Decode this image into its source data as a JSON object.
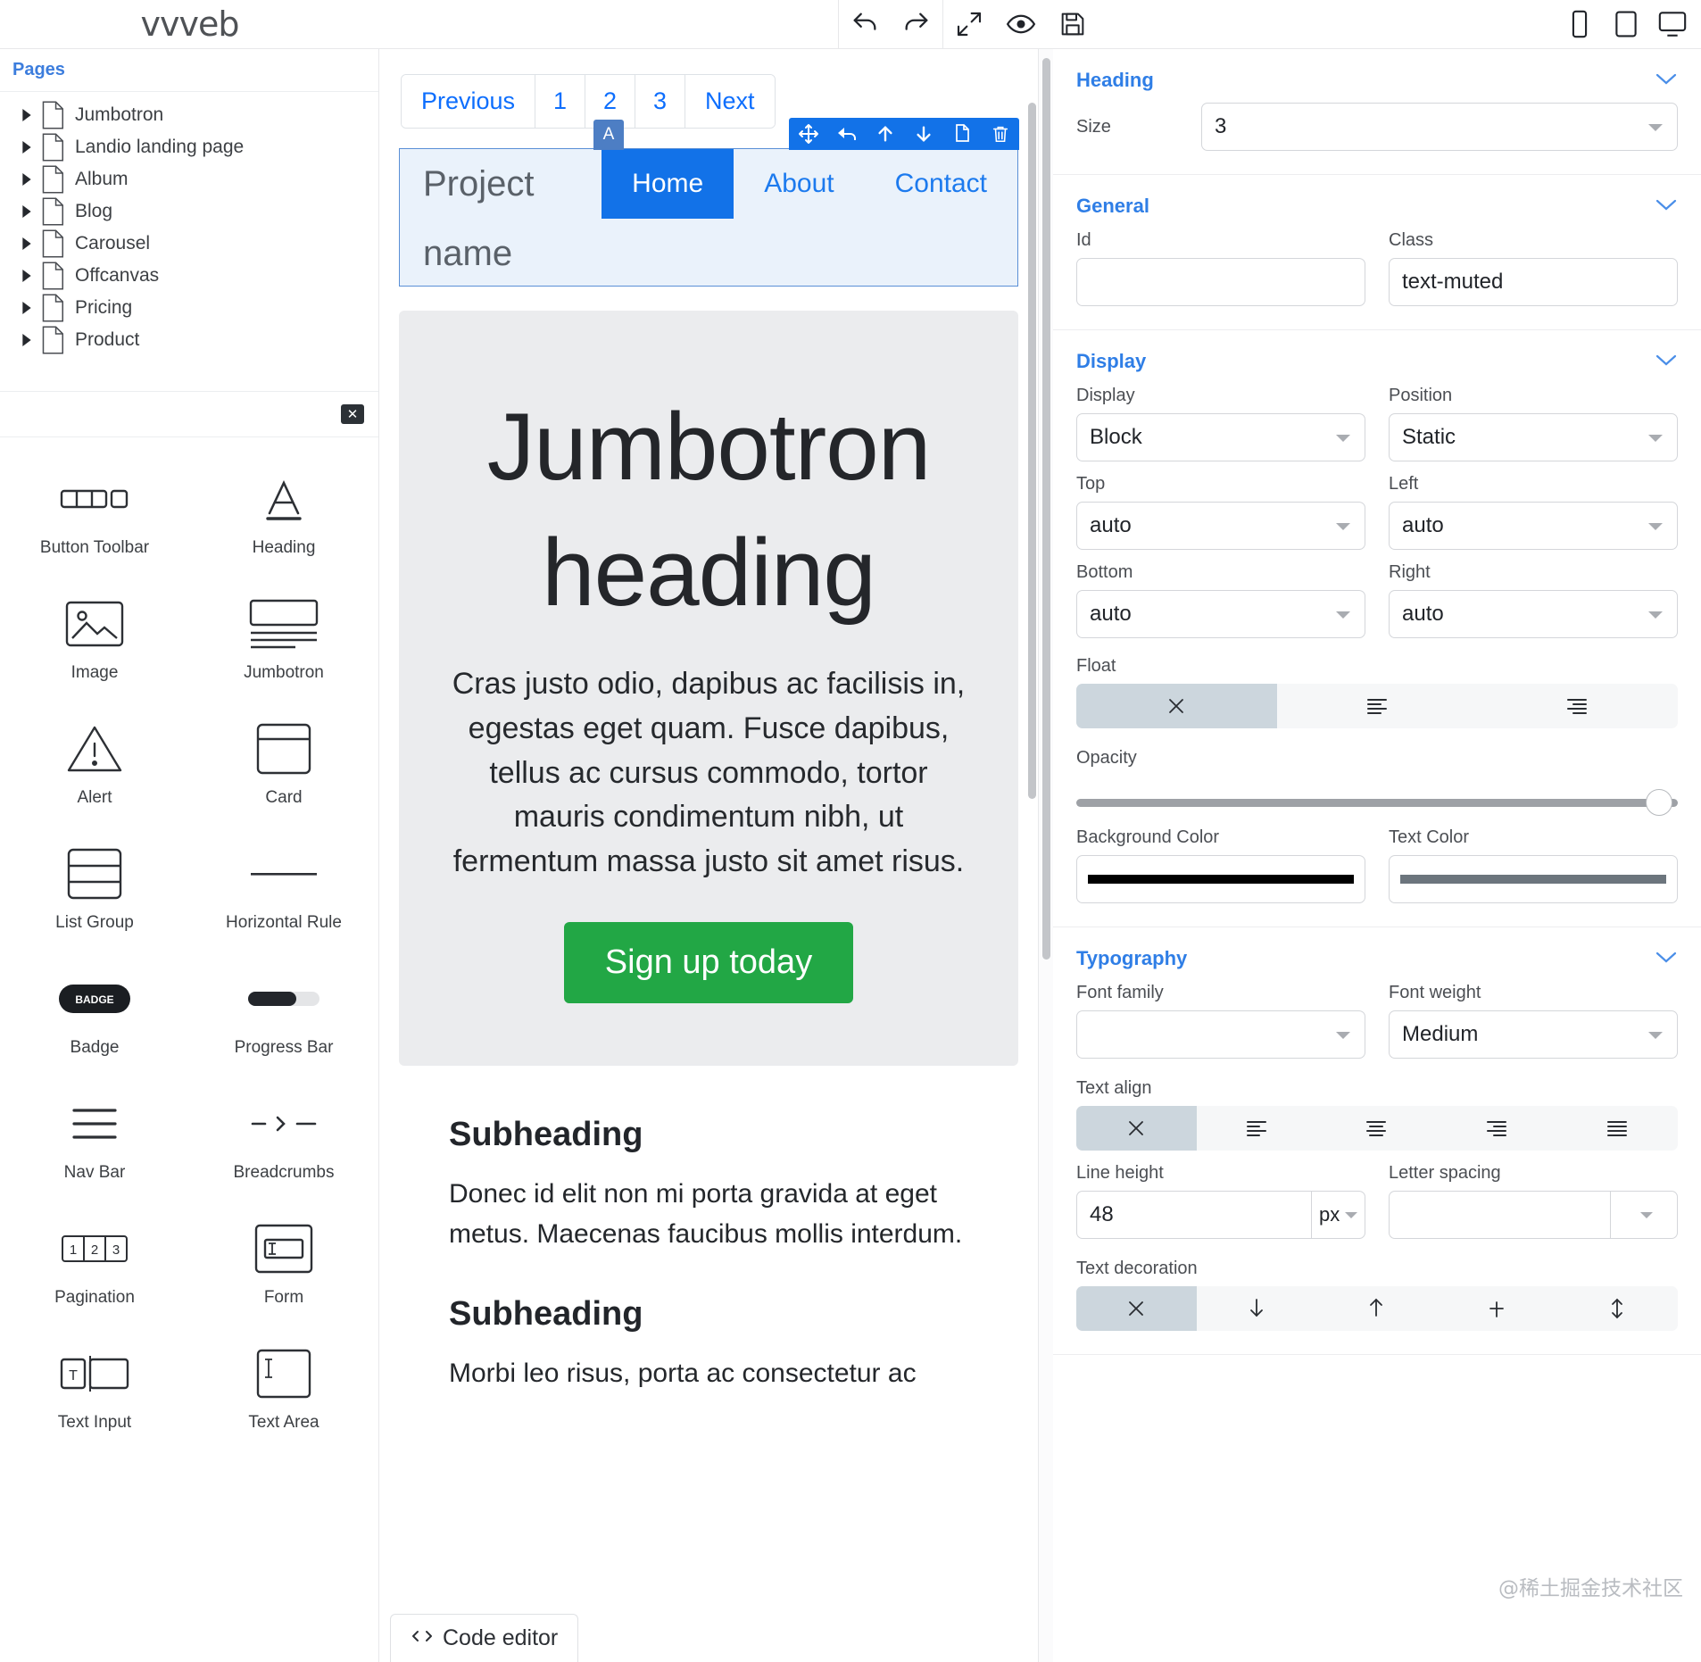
{
  "app": {
    "logo": "vvveb"
  },
  "topbar": {
    "undo_label": "undo-icon",
    "redo_label": "redo-icon",
    "fullscreen_label": "fullscreen-icon",
    "preview_label": "preview-eye-icon",
    "save_label": "save-icon",
    "devices": [
      "mobile",
      "tablet",
      "desktop"
    ]
  },
  "sidebar": {
    "pages_title": "Pages",
    "pages": [
      {
        "label": "Jumbotron"
      },
      {
        "label": "Landio landing page"
      },
      {
        "label": "Album"
      },
      {
        "label": "Blog"
      },
      {
        "label": "Carousel"
      },
      {
        "label": "Offcanvas"
      },
      {
        "label": "Pricing"
      },
      {
        "label": "Product"
      }
    ],
    "components": [
      {
        "label": "Button Toolbar",
        "icon": "button-toolbar-icon"
      },
      {
        "label": "Heading",
        "icon": "heading-icon"
      },
      {
        "label": "Image",
        "icon": "image-icon"
      },
      {
        "label": "Jumbotron",
        "icon": "jumbotron-icon"
      },
      {
        "label": "Alert",
        "icon": "alert-icon"
      },
      {
        "label": "Card",
        "icon": "card-icon"
      },
      {
        "label": "List Group",
        "icon": "list-group-icon"
      },
      {
        "label": "Horizontal Rule",
        "icon": "horizontal-rule-icon"
      },
      {
        "label": "Badge",
        "icon": "badge-icon"
      },
      {
        "label": "Progress Bar",
        "icon": "progress-bar-icon"
      },
      {
        "label": "Nav Bar",
        "icon": "nav-bar-icon"
      },
      {
        "label": "Breadcrumbs",
        "icon": "breadcrumbs-icon"
      },
      {
        "label": "Pagination",
        "icon": "pagination-icon"
      },
      {
        "label": "Form",
        "icon": "form-icon"
      },
      {
        "label": "Text Input",
        "icon": "text-input-icon"
      },
      {
        "label": "Text Area",
        "icon": "text-area-icon"
      }
    ]
  },
  "canvas": {
    "pagination": [
      "Previous",
      "1",
      "2",
      "3",
      "Next"
    ],
    "navbar": {
      "brand": "Project name",
      "links": [
        {
          "label": "Home",
          "active": true
        },
        {
          "label": "About",
          "active": false
        },
        {
          "label": "Contact",
          "active": false
        }
      ],
      "selection_badge": "A"
    },
    "jumbotron": {
      "heading": "Jumbotron heading",
      "paragraph": "Cras justo odio, dapibus ac facilisis in, egestas eget quam. Fusce dapibus, tellus ac cursus commodo, tortor mauris condimentum nibh, ut fermentum massa justo sit amet risus.",
      "button": "Sign up today"
    },
    "subheadings": [
      {
        "title": "Subheading",
        "text": "Donec id elit non mi porta gravida at eget metus. Maecenas faucibus mollis interdum."
      },
      {
        "title": "Subheading",
        "text": "Morbi leo risus, porta ac consectetur ac"
      }
    ],
    "code_editor": "Code editor"
  },
  "inspector": {
    "sections": {
      "heading": {
        "title": "Heading",
        "size_label": "Size",
        "size_value": "3"
      },
      "general": {
        "title": "General",
        "id_label": "Id",
        "id_value": "",
        "class_label": "Class",
        "class_value": "text-muted"
      },
      "display": {
        "title": "Display",
        "display_label": "Display",
        "display_value": "Block",
        "position_label": "Position",
        "position_value": "Static",
        "top_label": "Top",
        "top_value": "auto",
        "left_label": "Left",
        "left_value": "auto",
        "bottom_label": "Bottom",
        "bottom_value": "auto",
        "right_label": "Right",
        "right_value": "auto",
        "float_label": "Float",
        "float_options": [
          "none",
          "left",
          "right"
        ],
        "float_selected": 0,
        "opacity_label": "Opacity",
        "opacity_value": "100",
        "background_color_label": "Background Color",
        "background_color_value": "#000000",
        "text_color_label": "Text Color",
        "text_color_value": "#6c757d"
      },
      "typography": {
        "title": "Typography",
        "font_family_label": "Font family",
        "font_family_value": "",
        "font_weight_label": "Font weight",
        "font_weight_value": "Medium",
        "text_align_label": "Text align",
        "text_align_options": [
          "none",
          "left",
          "center",
          "right",
          "justify"
        ],
        "text_align_selected": 0,
        "line_height_label": "Line height",
        "line_height_value": "48",
        "line_height_unit": "px",
        "letter_spacing_label": "Letter spacing",
        "letter_spacing_value": "",
        "letter_spacing_unit": "",
        "text_decoration_label": "Text decoration",
        "text_decoration_options": [
          "none",
          "underline",
          "overline",
          "line-through",
          "both"
        ],
        "text_decoration_selected": 0
      }
    }
  },
  "watermark": "@稀土掘金技术社区",
  "colors": {
    "accent": "#2f7ee6",
    "brand_blue": "#1272e8",
    "green": "#22a745"
  }
}
